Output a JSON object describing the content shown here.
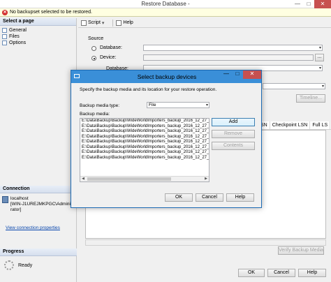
{
  "window": {
    "title": "Restore Database -",
    "min": "—",
    "max": "□",
    "close": "✕"
  },
  "error_bar": {
    "text": "No backupset selected to be restored."
  },
  "left_pane": {
    "select_page_header": "Select a page",
    "pages": [
      {
        "label": "General"
      },
      {
        "label": "Files"
      },
      {
        "label": "Options"
      }
    ],
    "connection_header": "Connection",
    "connection_server": "localhost",
    "connection_user": "[WIN-J1UREJMKPGC\\Administrator]",
    "view_connection_link": "View connection properties",
    "progress_header": "Progress",
    "progress_status": "Ready"
  },
  "toolbar": {
    "script_label": "Script",
    "help_label": "Help"
  },
  "source": {
    "label": "Source",
    "database_label": "Database:",
    "device_label": "Device:",
    "device_browse": "...",
    "sub_database_label": "Database:",
    "timeline_button": "Timeline..."
  },
  "grid": {
    "columns": [
      "SN",
      "Checkpoint LSN",
      "Full LS"
    ]
  },
  "verify_button": "Verify Backup Media",
  "footer": {
    "ok": "OK",
    "cancel": "Cancel",
    "help": "Help"
  },
  "dialog": {
    "title": "Select backup devices",
    "description": "Specify the backup media and its location for your restore operation.",
    "media_type_label": "Backup media type:",
    "media_type_value": "File",
    "media_label": "Backup media:",
    "media_items": [
      "E:\\Data\\Backup\\Backup\\WideWorldImporters_backup_2016_12_27_",
      "E:\\Data\\Backup\\Backup\\WideWorldImporters_backup_2016_12_27_",
      "E:\\Data\\Backup\\Backup\\WideWorldImporters_backup_2016_12_27_",
      "E:\\Data\\Backup\\Backup\\WideWorldImporters_backup_2016_12_27_",
      "E:\\Data\\Backup\\Backup\\WideWorldImporters_backup_2016_12_27_",
      "E:\\Data\\Backup\\Backup\\WideWorldImporters_backup_2016_12_27_",
      "E:\\Data\\Backup\\Backup\\WideWorldImporters_backup_2016_12_27_",
      "E:\\Data\\Backup\\Backup\\WideWorldImporters_backup_2016_12_27_"
    ],
    "add_button": "Add",
    "remove_button": "Remove",
    "contents_button": "Contents",
    "ok_button": "OK",
    "cancel_button": "Cancel",
    "help_button": "Help"
  },
  "colors": {
    "dialog_title": "#3a8fd8",
    "close_button": "#c75050",
    "error_icon": "#d32f2f"
  }
}
